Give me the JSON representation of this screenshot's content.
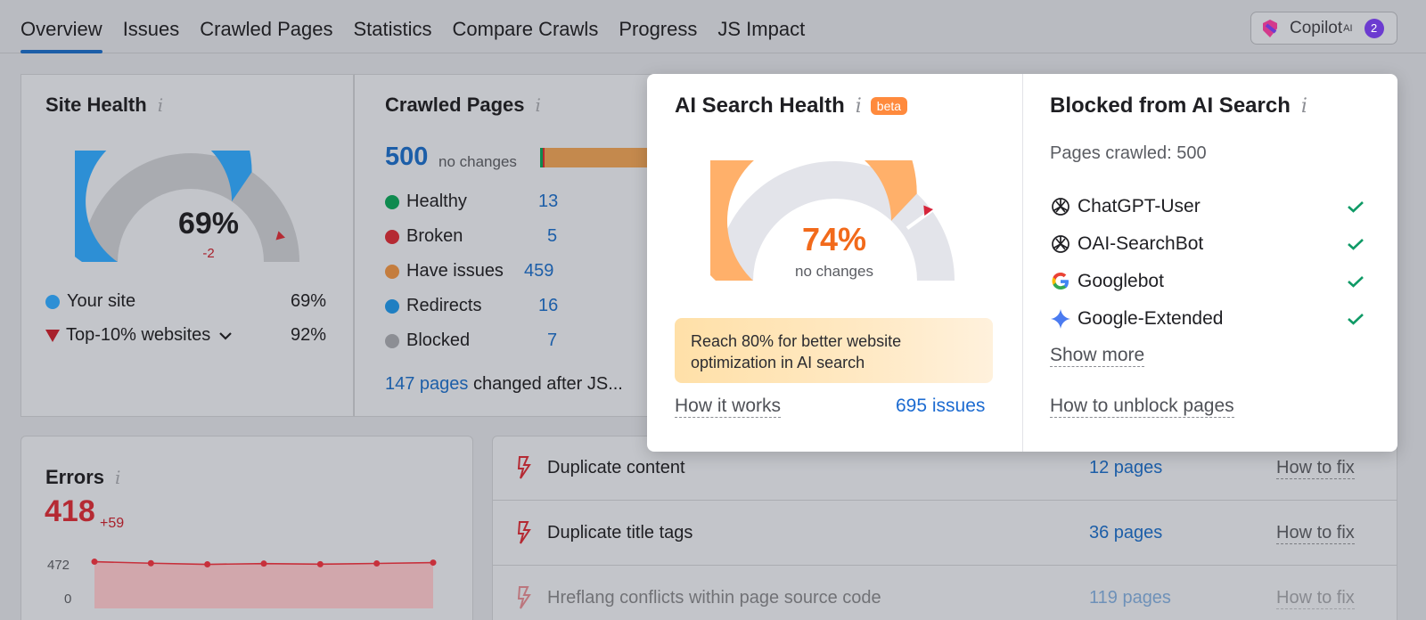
{
  "nav": {
    "tabs": [
      "Overview",
      "Issues",
      "Crawled Pages",
      "Statistics",
      "Compare Crawls",
      "Progress",
      "JS Impact"
    ],
    "copilot_label": "Copilot",
    "copilot_sup": "AI",
    "copilot_badge": "2"
  },
  "site_health": {
    "title": "Site Health",
    "value": "69%",
    "delta": "-2",
    "gauge_fraction": 0.69,
    "top10_fraction": 0.92,
    "legend": [
      {
        "label": "Your site",
        "value": "69%"
      },
      {
        "label": "Top-10% websites",
        "value": "92%"
      }
    ]
  },
  "crawled_pages": {
    "title": "Crawled Pages",
    "total": "500",
    "total_note": "no changes",
    "rows": [
      {
        "label": "Healthy",
        "value": "13",
        "color": "#0f8a4f"
      },
      {
        "label": "Broken",
        "value": "5",
        "color": "#b52a33"
      },
      {
        "label": "Have issues",
        "value": "459",
        "color": "#c47d3e"
      },
      {
        "label": "Redirects",
        "value": "16",
        "color": "#1f7fc2"
      },
      {
        "label": "Blocked",
        "value": "7",
        "color": "#8c8e94"
      }
    ],
    "js_link": "147 pages",
    "js_text": " changed after JS..."
  },
  "errors": {
    "title": "Errors",
    "value": "418",
    "delta": "+59",
    "y_max_label": "472",
    "y_min_label": "0",
    "series": [
      430,
      410,
      395,
      405,
      397,
      407,
      418
    ]
  },
  "issues": [
    {
      "name": "Duplicate content",
      "pages": "12 pages",
      "fix": "How to fix"
    },
    {
      "name": "Duplicate title tags",
      "pages": "36 pages",
      "fix": "How to fix"
    },
    {
      "name": "Hreflang conflicts within page source code",
      "pages": "119 pages",
      "fix": "How to fix"
    }
  ],
  "ai_health": {
    "title": "AI Search Health",
    "badge": "beta",
    "value": "74%",
    "note": "no changes",
    "gauge_fraction": 0.74,
    "target_fraction": 0.8,
    "tip": "Reach 80% for better website optimization in AI search",
    "how_link": "How it works",
    "issues_link": "695 issues"
  },
  "blocked": {
    "title": "Blocked from AI Search",
    "crawled": "Pages crawled: 500",
    "bots": [
      {
        "name": "ChatGPT-User",
        "icon": "openai-icon"
      },
      {
        "name": "OAI-SearchBot",
        "icon": "openai-icon"
      },
      {
        "name": "Googlebot",
        "icon": "google-icon"
      },
      {
        "name": "Google-Extended",
        "icon": "gemini-icon"
      }
    ],
    "show_more": "Show more",
    "unblock_link": "How to unblock pages"
  },
  "colors": {
    "accent_blue": "#1c6bd1",
    "gauge_blue": "#2d8fd5",
    "gauge_orange": "#ffb06a",
    "error_red": "#b52a33",
    "check_green": "#0f9a66"
  }
}
